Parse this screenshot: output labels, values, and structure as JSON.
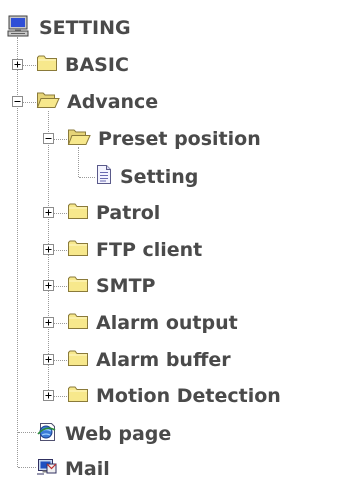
{
  "tree": {
    "root": {
      "label": "SETTING",
      "icon": "computer-icon"
    },
    "basic": {
      "label": "BASIC",
      "icon": "folder-closed-icon",
      "expander": "plus"
    },
    "advance": {
      "label": "Advance",
      "icon": "folder-open-icon",
      "expander": "minus"
    },
    "preset_position": {
      "label": "Preset position",
      "icon": "folder-open-icon",
      "expander": "minus"
    },
    "setting": {
      "label": "Setting",
      "icon": "document-icon"
    },
    "patrol": {
      "label": "Patrol",
      "icon": "folder-closed-icon",
      "expander": "plus"
    },
    "ftp_client": {
      "label": "FTP client",
      "icon": "folder-closed-icon",
      "expander": "plus"
    },
    "smtp": {
      "label": "SMTP",
      "icon": "folder-closed-icon",
      "expander": "plus"
    },
    "alarm_output": {
      "label": "Alarm output",
      "icon": "folder-closed-icon",
      "expander": "plus"
    },
    "alarm_buffer": {
      "label": "Alarm buffer",
      "icon": "folder-closed-icon",
      "expander": "plus"
    },
    "motion_detection": {
      "label": "Motion Detection",
      "icon": "folder-closed-icon",
      "expander": "plus"
    },
    "web_page": {
      "label": "Web page",
      "icon": "web-page-icon"
    },
    "mail": {
      "label": "Mail",
      "icon": "mail-icon"
    }
  },
  "colors": {
    "text": "#4a4a4a",
    "folder_fill": "#f7e88c",
    "folder_edge": "#8a7a3a",
    "connector": "#9a9a9a"
  }
}
